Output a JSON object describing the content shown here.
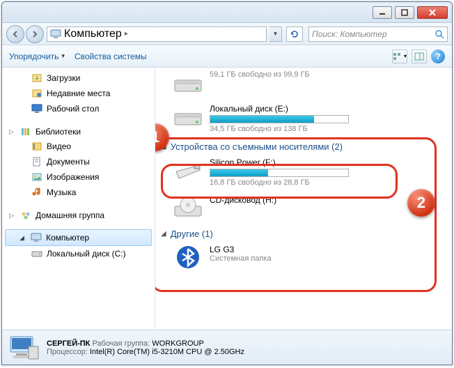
{
  "titlebar": {},
  "address": {
    "location": "Компьютер",
    "search_placeholder": "Поиск: Компьютер"
  },
  "toolbar": {
    "organize": "Упорядочить",
    "props": "Свойства системы"
  },
  "sidebar": {
    "downloads": "Загрузки",
    "recent": "Недавние места",
    "desktop": "Рабочий стол",
    "libraries": "Библиотеки",
    "video": "Видео",
    "documents": "Документы",
    "pictures": "Изображения",
    "music": "Музыка",
    "homegroup": "Домашняя группа",
    "computer": "Компьютер",
    "localdisk_c": "Локальный диск (C:)"
  },
  "content": {
    "drive0_sub": "59,1 ГБ свободно из 99,9 ГБ",
    "drive_e_name": "Локальный диск (E:)",
    "drive_e_sub": "34,5 ГБ свободно из 138 ГБ",
    "group_removable": "Устройства со съемными носителями (2)",
    "drive_f_name": "Silicon Power (F:)",
    "drive_f_sub": "16,8 ГБ свободно из 28,8 ГБ",
    "drive_h_name": "CD-дисковод (H:)",
    "group_other": "Другие (1)",
    "lg_name": "LG G3",
    "lg_sub": "Системная папка"
  },
  "status": {
    "pcname": "СЕРГЕЙ-ПК",
    "workgroup_label": "Рабочая группа:",
    "workgroup": "WORKGROUP",
    "cpu_label": "Процессор:",
    "cpu": "Intel(R) Core(TM) i5-3210M CPU @ 2.50GHz"
  },
  "annotations": {
    "badge1": "1",
    "badge2": "2"
  }
}
